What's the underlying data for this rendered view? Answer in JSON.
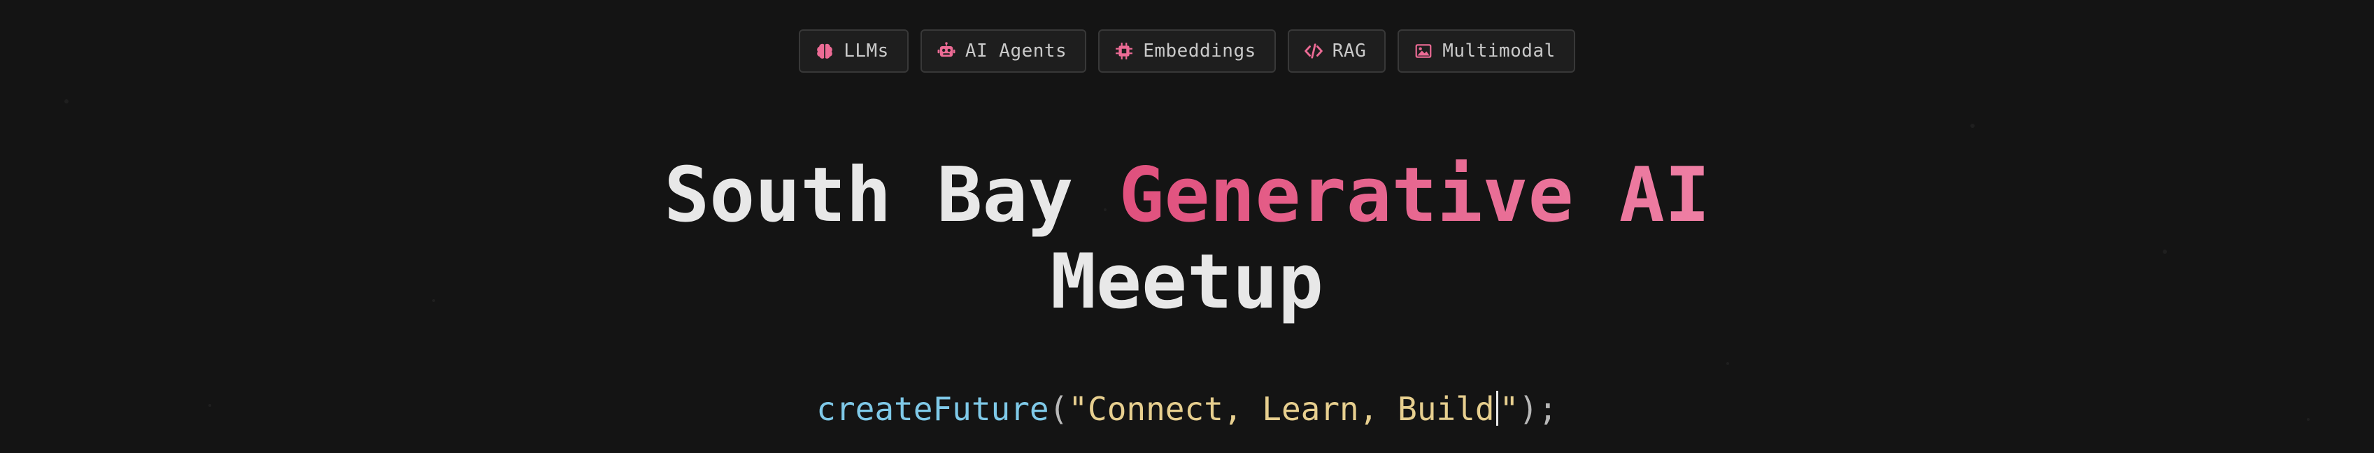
{
  "tags": [
    {
      "label": "LLMs",
      "icon": "brain-icon"
    },
    {
      "label": "AI Agents",
      "icon": "robot-icon"
    },
    {
      "label": "Embeddings",
      "icon": "chip-icon"
    },
    {
      "label": "RAG",
      "icon": "code-icon"
    },
    {
      "label": "Multimodal",
      "icon": "image-icon"
    }
  ],
  "hero": {
    "title_part1": "South Bay ",
    "title_accent": "Generative AI",
    "title_line2": "Meetup"
  },
  "code": {
    "function": "createFuture",
    "open": "(",
    "string_open": "\"Connect, Learn, Build",
    "string_close": "\"",
    "close": ");"
  },
  "colors": {
    "background": "#141414",
    "accent": "#e0507d",
    "function": "#7fc9e8",
    "string": "#e7cf8f"
  }
}
